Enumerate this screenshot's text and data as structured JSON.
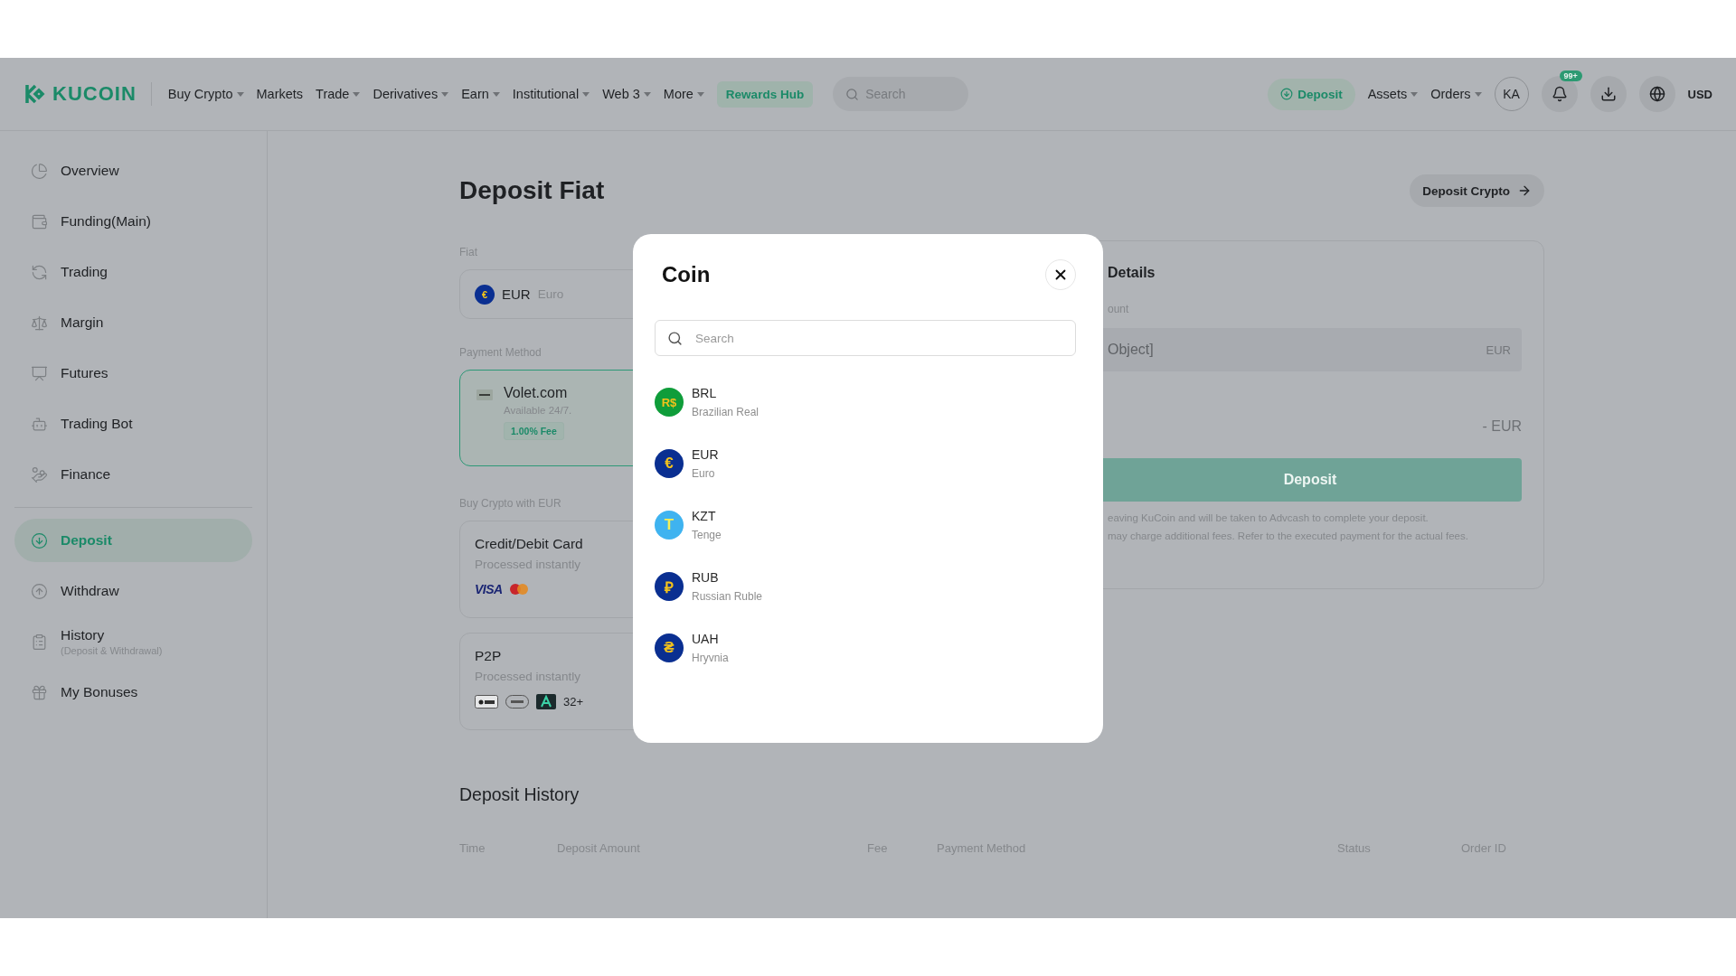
{
  "header": {
    "logo": "KUCOIN",
    "nav": [
      {
        "label": "Buy Crypto",
        "dropdown": true
      },
      {
        "label": "Markets",
        "dropdown": false
      },
      {
        "label": "Trade",
        "dropdown": true
      },
      {
        "label": "Derivatives",
        "dropdown": true
      },
      {
        "label": "Earn",
        "dropdown": true
      },
      {
        "label": "Institutional",
        "dropdown": true
      },
      {
        "label": "Web 3",
        "dropdown": true
      },
      {
        "label": "More",
        "dropdown": true
      }
    ],
    "rewards": "Rewards Hub",
    "search": {
      "placeholder": "Search"
    },
    "deposit": "Deposit",
    "menus": [
      {
        "label": "Assets"
      },
      {
        "label": "Orders"
      }
    ],
    "avatar": "KA",
    "notification_badge": "99+",
    "currency": "USD"
  },
  "sidebar": {
    "sections": [
      {
        "items": [
          {
            "label": "Overview",
            "selected": false
          },
          {
            "label": "Funding(Main)",
            "selected": false
          },
          {
            "label": "Trading",
            "selected": false
          },
          {
            "label": "Margin",
            "selected": false
          },
          {
            "label": "Futures",
            "selected": false
          },
          {
            "label": "Trading Bot",
            "selected": false
          },
          {
            "label": "Finance",
            "selected": false
          }
        ]
      },
      {
        "items": [
          {
            "label": "Deposit",
            "selected": true
          },
          {
            "label": "Withdraw",
            "selected": false
          },
          {
            "label": "History",
            "subtitle": "(Deposit & Withdrawal)",
            "selected": false
          },
          {
            "label": "My Bonuses",
            "selected": false
          }
        ]
      }
    ]
  },
  "page": {
    "title": "Deposit Fiat",
    "deposit_crypto": "Deposit Crypto"
  },
  "fiat": {
    "label": "Fiat",
    "symbol": "€",
    "code": "EUR",
    "name": "Euro"
  },
  "payment": {
    "label": "Payment Method",
    "methods": [
      {
        "name": "Volet.com",
        "note": "Available 24/7.",
        "fee": "1.00% Fee",
        "selected": true
      }
    ]
  },
  "buy": {
    "label": "Buy Crypto with EUR",
    "options": [
      {
        "kind": "card",
        "title": "Credit/Debit Card",
        "note": "Processed instantly",
        "brand": "VISA"
      },
      {
        "kind": "p2p",
        "title": "P2P",
        "note": "Processed instantly",
        "more": "32+"
      }
    ]
  },
  "details": {
    "title": "Details",
    "amount_label": "ount",
    "amount_value": "Object]",
    "amount_unit": "EUR",
    "total": "- EUR",
    "button": "Deposit",
    "notes": [
      "eaving KuCoin and will be taken to Advcash to complete your deposit.",
      "may charge additional fees. Refer to the executed payment for the actual fees."
    ]
  },
  "history": {
    "title": "Deposit History",
    "columns": [
      "Time",
      "Deposit Amount",
      "Fee",
      "Payment Method",
      "Status",
      "Order ID"
    ]
  },
  "modal": {
    "title": "Coin",
    "search": {
      "placeholder": "Search"
    },
    "coins": [
      {
        "symbol": "R$",
        "code": "BRL",
        "name": "Brazilian Real",
        "color": "#0f9d3a"
      },
      {
        "symbol": "€",
        "code": "EUR",
        "name": "Euro",
        "color": "#0a2f91"
      },
      {
        "symbol": "T",
        "code": "KZT",
        "name": "Tenge",
        "color": "#3fb3f0"
      },
      {
        "symbol": "₽",
        "code": "RUB",
        "name": "Russian Ruble",
        "color": "#0a2f91"
      },
      {
        "symbol": "₴",
        "code": "UAH",
        "name": "Hryvnia",
        "color": "#0a2f91"
      }
    ]
  }
}
